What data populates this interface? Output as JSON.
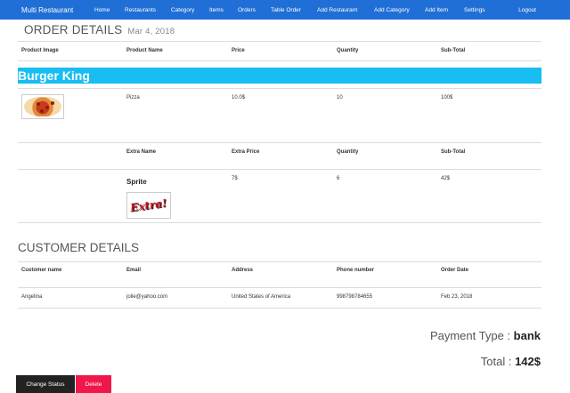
{
  "nav": {
    "brand": "Multi Restaurant",
    "items": [
      "Home",
      "Restaurants",
      "Category",
      "Items",
      "Orders",
      "Table Order",
      "Add Restaurant",
      "Add Category",
      "Add Item",
      "Settings"
    ],
    "logout": "Logout"
  },
  "order": {
    "title": "ORDER DETAILS",
    "date": "Mar 4, 2018",
    "headers": [
      "Product Image",
      "Product Name",
      "Price",
      "Quantity",
      "Sub-Total"
    ],
    "restaurant": "Burger King",
    "item": {
      "name": "Pizza",
      "price": "10.0$",
      "quantity": "10",
      "subtotal": "100$"
    },
    "extra_headers": [
      "Extra Name",
      "Extra Price",
      "Quantity",
      "Sub-Total"
    ],
    "extra": {
      "name": "Sprite",
      "price": "7$",
      "quantity": "6",
      "subtotal": "42$",
      "logo_text": "Extra!"
    }
  },
  "customer": {
    "title": "CUSTOMER DETAILS",
    "headers": [
      "Customer name",
      "Email",
      "Address",
      "Phone number",
      "Order Date"
    ],
    "row": [
      "Angelina",
      "jolie@yahoo.com",
      "United States of America",
      "998798784655",
      "Feb 23, 2018"
    ]
  },
  "payment": {
    "label": "Payment Type : ",
    "value": "bank"
  },
  "total": {
    "label": "Total : ",
    "value": "142$"
  },
  "buttons": {
    "change_status": "Change Status",
    "delete": "Delete"
  },
  "colors": {
    "navbar": "#1f6fd6",
    "restaurant_bar": "#18bdf2",
    "delete": "#f0174b",
    "status": "#222222"
  }
}
